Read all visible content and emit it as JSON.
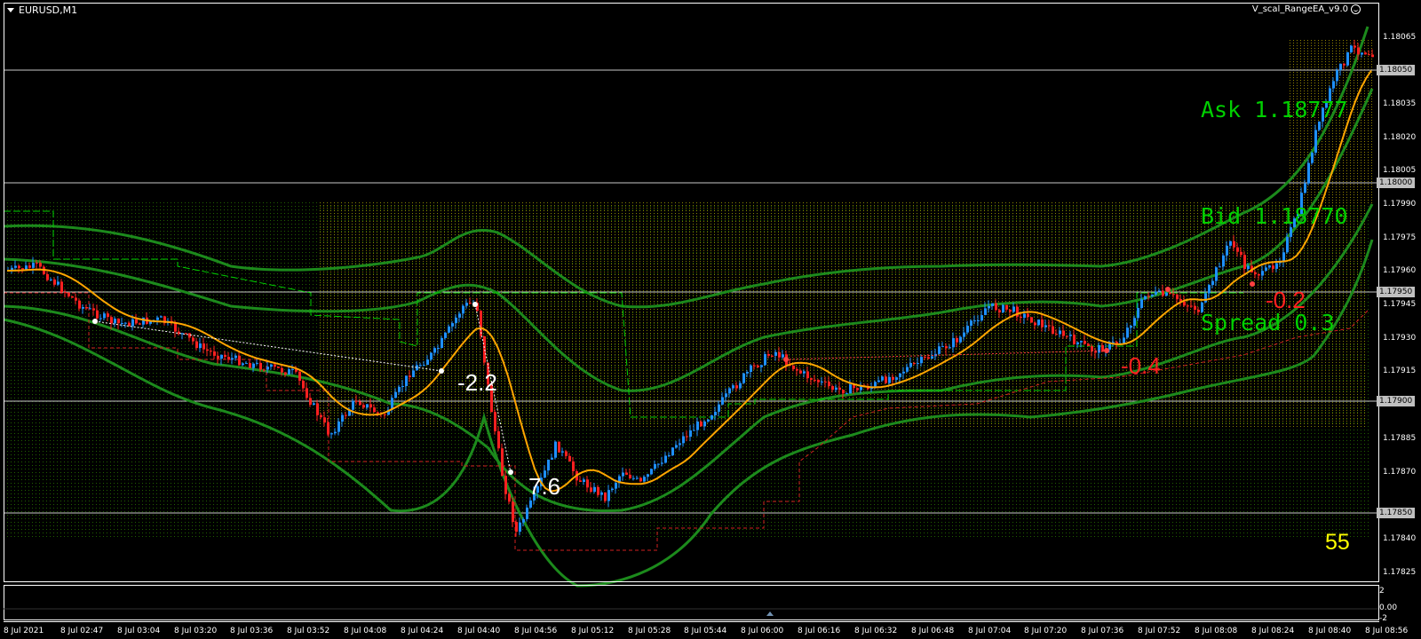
{
  "window": {
    "title": "EURUSD,M1",
    "expert_name": "V_scal_RangeEA_v9.0"
  },
  "info_panel": {
    "ask_line": "Ask 1.18777",
    "bid_line": "Bid 1.18770",
    "spread_line": "Spread 0.3",
    "color": "#00d000"
  },
  "score": {
    "value": "55",
    "color": "#ffff00"
  },
  "trade_labels": [
    {
      "text": "-2.2",
      "color": "#ffffff"
    },
    {
      "text": "7.6",
      "color": "#ffffff"
    },
    {
      "text": "-0.4",
      "color": "#ff2020"
    },
    {
      "text": "-0.2",
      "color": "#ff2020"
    }
  ],
  "price_axis": {
    "ticks": [
      "1.18065",
      "1.18035",
      "1.18020",
      "1.18005",
      "1.17990",
      "1.17975",
      "1.17960",
      "1.17945",
      "1.17930",
      "1.17915",
      "1.17885",
      "1.17870",
      "1.17840",
      "1.17825"
    ],
    "tagged_levels": [
      "1.18050",
      "1.18000",
      "1.17950",
      "1.17900",
      "1.17850"
    ]
  },
  "time_axis": {
    "labels": [
      "8 Jul 2021",
      "8 Jul 02:47",
      "8 Jul 03:04",
      "8 Jul 03:20",
      "8 Jul 03:36",
      "8 Jul 03:52",
      "8 Jul 04:08",
      "8 Jul 04:24",
      "8 Jul 04:40",
      "8 Jul 04:56",
      "8 Jul 05:12",
      "8 Jul 05:28",
      "8 Jul 05:44",
      "8 Jul 06:00",
      "8 Jul 06:16",
      "8 Jul 06:32",
      "8 Jul 06:48",
      "8 Jul 07:04",
      "8 Jul 07:20",
      "8 Jul 07:36",
      "8 Jul 07:52",
      "8 Jul 08:08",
      "8 Jul 08:24",
      "8 Jul 08:40",
      "8 Jul 08:56"
    ]
  },
  "subwindow": {
    "ticks": [
      "2",
      "0.00",
      "-2"
    ]
  },
  "colors": {
    "bull_candle": "#1e90ff",
    "bear_candle": "#ff2020",
    "moving_average": "#ffa500",
    "envelope_bands": "#1c8a1c",
    "grid_dots": "#c8b400",
    "level_lines": "#c8c8c8"
  },
  "icons": {
    "dropdown": "chevron-down-icon",
    "smiley": "smiley-icon"
  }
}
